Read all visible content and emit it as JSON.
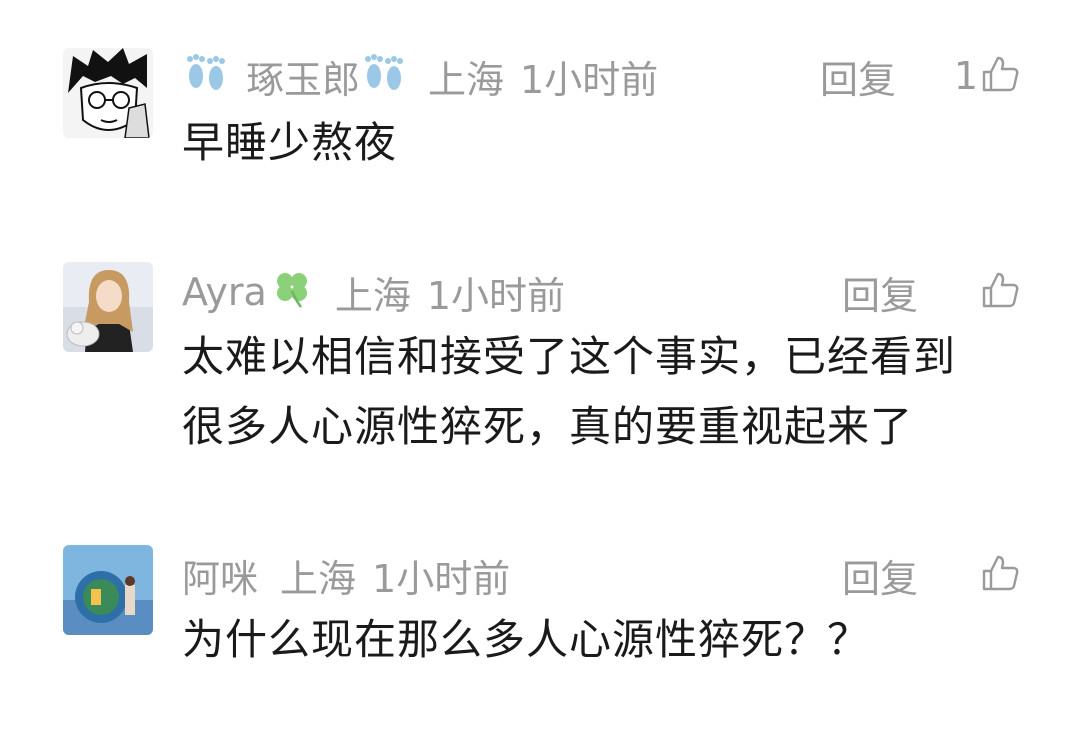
{
  "comments": [
    {
      "nickname": "琢玉郎",
      "nickname_decor_icon": "footprints-icon",
      "location": "上海",
      "time": "1小时前",
      "reply_label": "回复",
      "like_count": "1",
      "lines": [
        "早睡少熬夜"
      ]
    },
    {
      "nickname": "Ayra",
      "nickname_decor_icon": "four-leaf-clover-icon",
      "location": "上海",
      "time": "1小时前",
      "reply_label": "回复",
      "like_count": "",
      "lines": [
        "太难以相信和接受了这个事实，已经看到",
        "很多人心源性猝死，真的要重视起来了"
      ]
    },
    {
      "nickname": "阿咪",
      "location": "上海",
      "time": "1小时前",
      "reply_label": "回复",
      "like_count": "",
      "lines": [
        "为什么现在那么多人心源性猝死？？"
      ]
    }
  ],
  "colors": {
    "meta_text": "#9a9a9a",
    "body_text": "#1a1a1a",
    "footprint_blue": "#9cc8e8",
    "clover_green": "#8bd17a"
  }
}
